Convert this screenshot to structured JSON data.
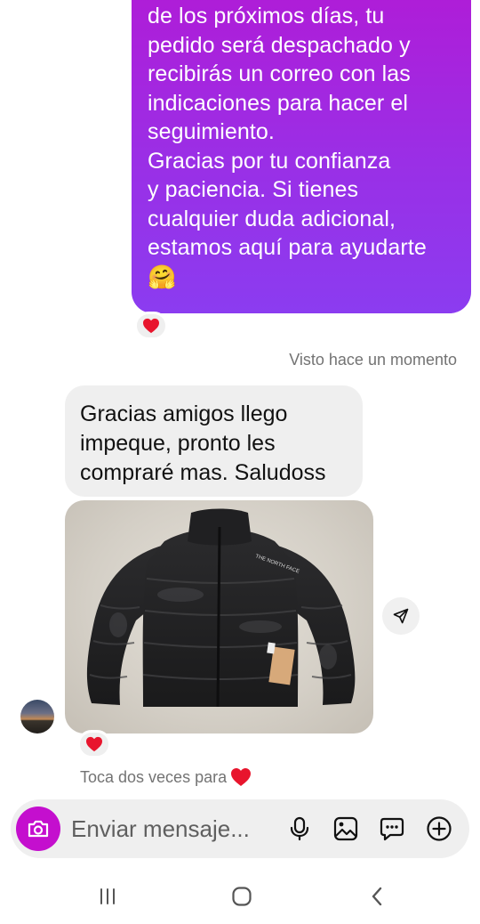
{
  "outgoing_message": {
    "lines": [
      "de los próximos días, tu",
      "pedido será despachado y",
      "recibirás un correo con las",
      "indicaciones para hacer el",
      "seguimiento.",
      "Gracias por tu confianza",
      "y paciencia. Si tienes",
      "cualquier duda adicional,",
      "estamos aquí para ayudarte"
    ],
    "emoji": "🤗",
    "reaction": "heart-icon"
  },
  "seen_status": "Visto hace un momento",
  "incoming_message": {
    "lines": [
      "Gracias amigos llego",
      "impeque, pronto les",
      "compraré mas. Saludoss"
    ],
    "photo": "black-puffer-jacket-photo",
    "photo_brand_text": "THE NORTH FACE",
    "reaction": "heart-icon"
  },
  "tap_hint": "Toca dos veces para",
  "composer": {
    "placeholder": "Enviar mensaje...",
    "icons": [
      "camera-icon",
      "microphone-icon",
      "gallery-icon",
      "sticker-icon",
      "add-icon"
    ]
  },
  "system_nav": {
    "buttons": [
      "recent-apps-icon",
      "home-icon",
      "back-icon"
    ]
  },
  "colors": {
    "outgoing_gradient_top": "#b11bd6",
    "outgoing_gradient_bottom": "#8b3cf0",
    "camera_button": "#c40fce",
    "heart": "#e8152d",
    "muted_text": "#737373"
  }
}
